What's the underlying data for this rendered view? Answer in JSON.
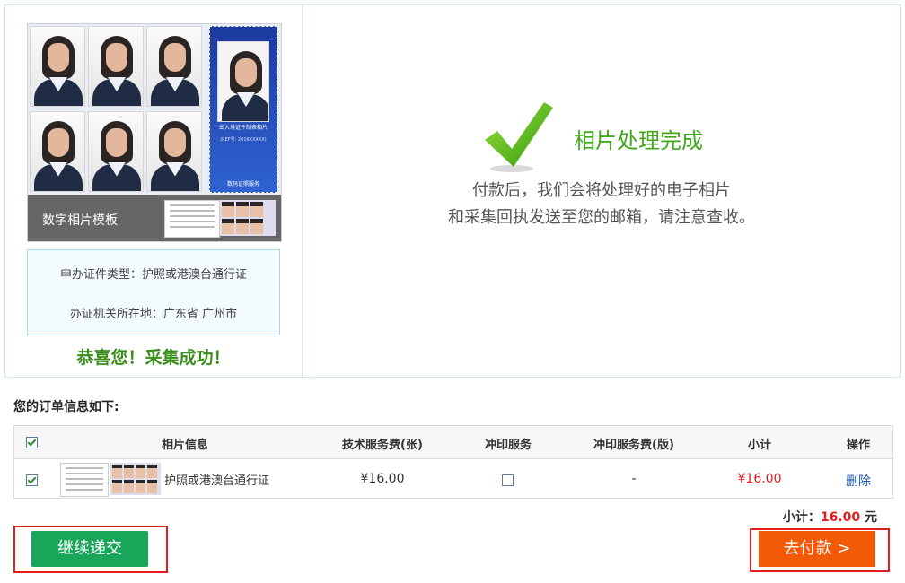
{
  "left_panel": {
    "template_label": "数字相片模板",
    "card_caption": "出入境证件制表相片",
    "card_sub": "(REF号: 2016XXXXX)",
    "card_logo_text": "数码证照服务",
    "apply_type": "申办证件类型：护照或港澳台通行证",
    "office_location": "办证机关所在地：广东省  广州市",
    "congrats": "恭喜您！采集成功！"
  },
  "right_panel": {
    "title": "相片处理完成",
    "message_line1": "付款后，我们会将处理好的电子相片",
    "message_line2": "和采集回执发送至您的邮箱，请注意查收。",
    "check_icon": "green-check-icon"
  },
  "order": {
    "heading": "您的订单信息如下:",
    "columns": [
      "相片信息",
      "技术服务费(张)",
      "冲印服务",
      "冲印服务费(版)",
      "小计",
      "操作"
    ],
    "header_checked": true,
    "rows": [
      {
        "checked": true,
        "title": "护照或港澳台通行证",
        "tech_fee": "¥16.00",
        "print_service_checked": false,
        "print_fee": "-",
        "subtotal": "¥16.00",
        "action": "删除"
      }
    ],
    "total_label": "小计：",
    "total_amount": "16.00",
    "total_unit": " 元"
  },
  "buttons": {
    "continue": "继续递交",
    "pay": "去付款 >"
  },
  "colors": {
    "accent_green": "#44a81e",
    "continue_green": "#19a55a",
    "pay_orange": "#f25a06",
    "price_red": "#e21b1b",
    "highlight_red": "#e21b1b"
  }
}
